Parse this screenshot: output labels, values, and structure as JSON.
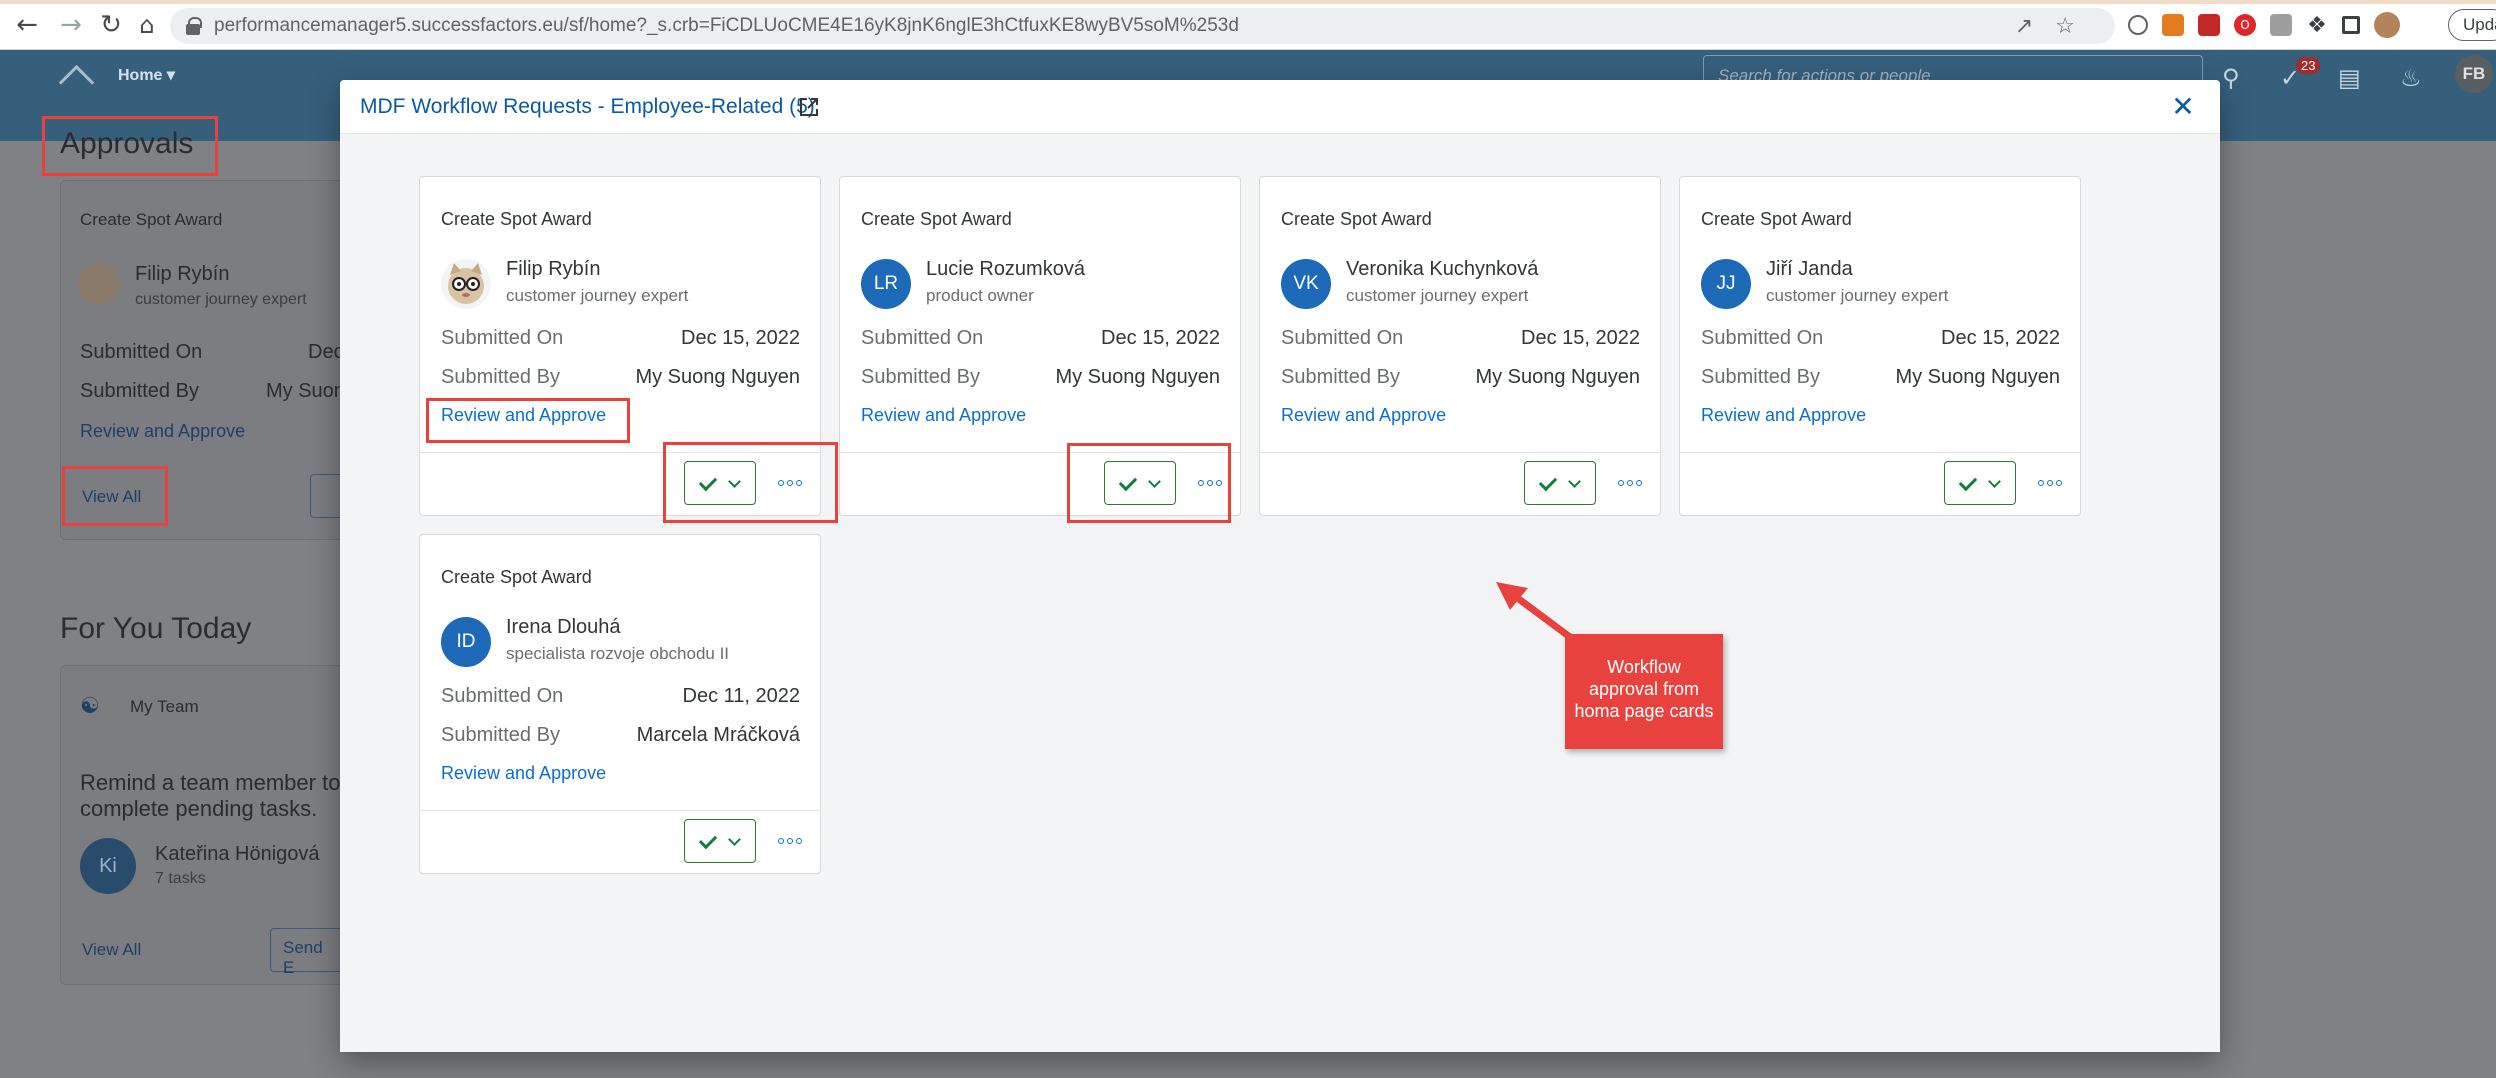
{
  "browser": {
    "url": "performancemanager5.successfactors.eu/sf/home?_s.crb=FiCDLUoCME4E16yK8jnK6nglE3hCtfuxKE8wyBV5soM%253d",
    "update_label": "Update"
  },
  "shell": {
    "home_label": "Home",
    "search_placeholder": "Search for actions or people",
    "notification_count": "23",
    "user_initials": "FB"
  },
  "background": {
    "approvals_title": "Approvals",
    "approval_card": {
      "type": "Create Spot Award",
      "name": "Filip Rybín",
      "role": "customer journey expert",
      "submitted_on_label": "Submitted On",
      "submitted_on_value": "Dec",
      "submitted_by_label": "Submitted By",
      "submitted_by_value": "My Suon",
      "review_link": "Review and Approve",
      "view_all": "View All"
    },
    "for_you_title": "For You Today",
    "team_card": {
      "title": "My Team",
      "message_line1": "Remind a team member to",
      "message_line2": "complete pending tasks.",
      "avatar_initials": "Ki",
      "member_name": "Kateřina Hönigová",
      "member_tasks": "7 tasks",
      "view_all": "View All",
      "send_button": "Send E"
    }
  },
  "dialog": {
    "title": "MDF Workflow Requests - Employee-Related (5)",
    "cards": [
      {
        "type": "Create Spot Award",
        "initials": "",
        "has_photo": true,
        "name": "Filip Rybín",
        "role": "customer journey expert",
        "submitted_on_label": "Submitted On",
        "submitted_on": "Dec 15, 2022",
        "submitted_by_label": "Submitted By",
        "submitted_by": "My Suong Nguyen",
        "link": "Review and Approve"
      },
      {
        "type": "Create Spot Award",
        "initials": "LR",
        "has_photo": false,
        "name": "Lucie Rozumková",
        "role": "product owner",
        "submitted_on_label": "Submitted On",
        "submitted_on": "Dec 15, 2022",
        "submitted_by_label": "Submitted By",
        "submitted_by": "My Suong Nguyen",
        "link": "Review and Approve"
      },
      {
        "type": "Create Spot Award",
        "initials": "VK",
        "has_photo": false,
        "name": "Veronika Kuchynková",
        "role": "customer journey expert",
        "submitted_on_label": "Submitted On",
        "submitted_on": "Dec 15, 2022",
        "submitted_by_label": "Submitted By",
        "submitted_by": "My Suong Nguyen",
        "link": "Review and Approve"
      },
      {
        "type": "Create Spot Award",
        "initials": "JJ",
        "has_photo": false,
        "name": "Jiří Janda",
        "role": "customer journey expert",
        "submitted_on_label": "Submitted On",
        "submitted_on": "Dec 15, 2022",
        "submitted_by_label": "Submitted By",
        "submitted_by": "My Suong Nguyen",
        "link": "Review and Approve"
      },
      {
        "type": "Create Spot Award",
        "initials": "ID",
        "has_photo": false,
        "name": "Irena Dlouhá",
        "role": "specialista rozvoje obchodu II",
        "submitted_on_label": "Submitted On",
        "submitted_on": "Dec 11, 2022",
        "submitted_by_label": "Submitted By",
        "submitted_by": "Marcela Mráčková",
        "link": "Review and Approve"
      }
    ]
  },
  "annotation": {
    "callout_line1": "Workflow",
    "callout_line2": "approval from",
    "callout_line3": "homa page cards",
    "accent_color": "#e8423f"
  }
}
